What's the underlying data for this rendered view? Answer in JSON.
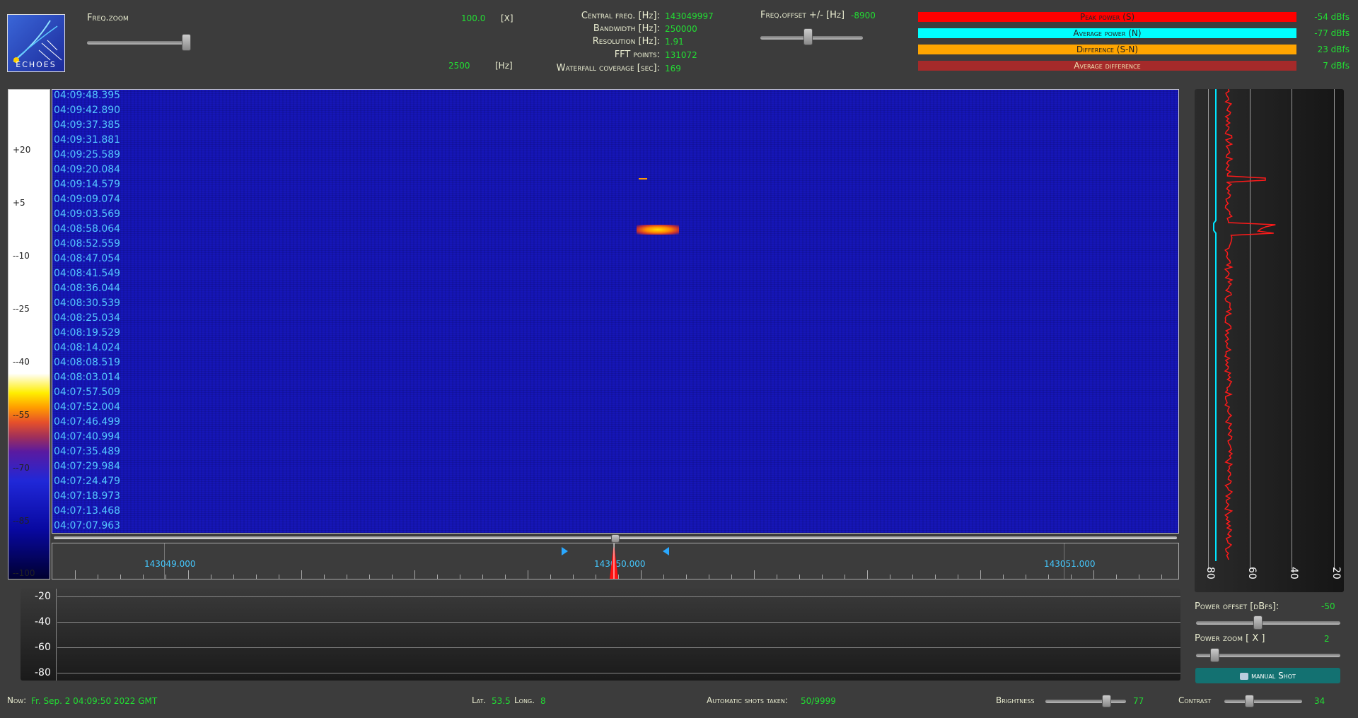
{
  "header": {
    "freq_zoom_label": "Freq.zoom",
    "freq_zoom_value": "100.0",
    "freq_zoom_unit": "[X]",
    "freq_zoom_hz": "2500",
    "freq_zoom_hz_unit": "[Hz]",
    "central_freq_label": "Central freq. [Hz]:",
    "central_freq_value": "143049997",
    "bandwidth_label": "Bandwidth [Hz]:",
    "bandwidth_value": "250000",
    "resolution_label": "Resolution [Hz]:",
    "resolution_value": "1.91",
    "fft_label": "FFT points:",
    "fft_value": "131072",
    "waterfall_label": "Waterfall coverage [sec]:",
    "waterfall_value": "169",
    "freq_offset_label": "Freq.offset +/- [Hz]",
    "freq_offset_value": "-8900"
  },
  "logo_text": "ECHOES",
  "power_bars": [
    {
      "label": "Peak power (S)",
      "value": "-54 dBfs",
      "color": "#ff0000"
    },
    {
      "label": "Average power (N)",
      "value": "-77 dBfs",
      "color": "#00ffff"
    },
    {
      "label": "Difference (S-N)",
      "value": "23 dBfs",
      "color": "#ffa500"
    },
    {
      "label": "Average difference",
      "value": "7 dBfs",
      "color": "#a52a2a"
    }
  ],
  "colorbar_labels": [
    "+20",
    "+5",
    "--10",
    "--25",
    "--40",
    "--55",
    "--70",
    "--85",
    "--100"
  ],
  "timestamps": [
    "04:09:48.395",
    "04:09:42.890",
    "04:09:37.385",
    "04:09:31.881",
    "04:09:25.589",
    "04:09:20.084",
    "04:09:14.579",
    "04:09:09.074",
    "04:09:03.569",
    "04:08:58.064",
    "04:08:52.559",
    "04:08:47.054",
    "04:08:41.549",
    "04:08:36.044",
    "04:08:30.539",
    "04:08:25.034",
    "04:08:19.529",
    "04:08:14.024",
    "04:08:08.519",
    "04:08:03.014",
    "04:07:57.509",
    "04:07:52.004",
    "04:07:46.499",
    "04:07:40.994",
    "04:07:35.489",
    "04:07:29.984",
    "04:07:24.479",
    "04:07:18.973",
    "04:07:13.468",
    "04:07:07.963"
  ],
  "freq_labels": [
    "143049.000",
    "143050.000",
    "143051.000"
  ],
  "power_graph_labels": [
    "-20",
    "-40",
    "-60",
    "-80"
  ],
  "spectrum_labels": [
    "80",
    "60",
    "40",
    "20"
  ],
  "controls": {
    "power_offset_label": "Power offset [dBfs]:",
    "power_offset_value": "-50",
    "power_zoom_label": "Power zoom [ X ]",
    "power_zoom_value": "2",
    "manual_shot_label": "manual Shot"
  },
  "footer": {
    "now_label": "Now:",
    "now_value": "Fr. Sep. 2 04:09:50 2022 GMT",
    "lat_label": "Lat.",
    "lat_value": "53.5",
    "long_label": "Long.",
    "long_value": "8",
    "shots_label": "Automatic shots taken:",
    "shots_value": "50/9999",
    "brightness_label": "Brightness",
    "brightness_value": "77",
    "contrast_label": "Contrast",
    "contrast_value": "34"
  }
}
